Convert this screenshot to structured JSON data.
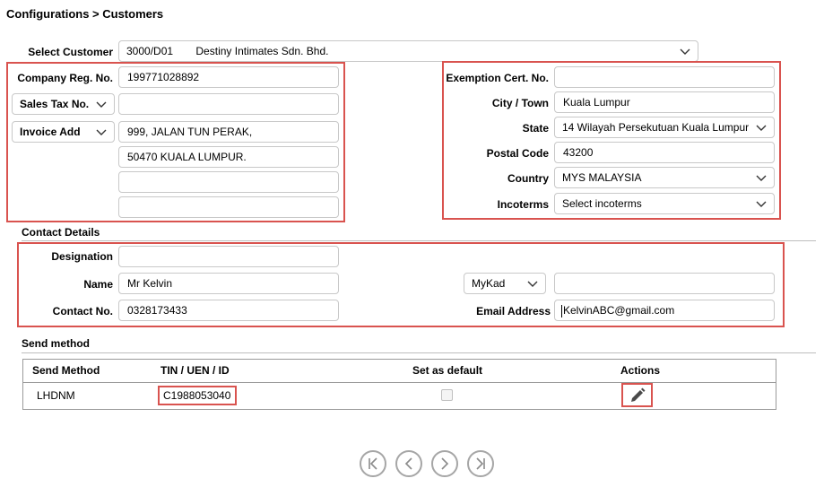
{
  "breadcrumb": "Configurations > Customers",
  "select_customer": {
    "label": "Select Customer",
    "code": "3000/D01",
    "name": "Destiny Intimates Sdn. Bhd."
  },
  "left": {
    "company_reg_label": "Company Reg. No.",
    "company_reg_value": "199771028892",
    "sales_tax_select": "Sales Tax No.",
    "sales_tax_value": "",
    "invoice_add_select": "Invoice Add",
    "address_lines": [
      "999, JALAN TUN PERAK,",
      "50470 KUALA LUMPUR.",
      "",
      ""
    ]
  },
  "right": {
    "exemption_label": "Exemption Cert. No.",
    "exemption_value": "",
    "city_label": "City / Town",
    "city_value": "Kuala Lumpur",
    "state_label": "State",
    "state_value": "14 Wilayah Persekutuan Kuala Lumpur",
    "postal_label": "Postal Code",
    "postal_value": "43200",
    "country_label": "Country",
    "country_value": "MYS MALAYSIA",
    "incoterms_label": "Incoterms",
    "incoterms_value": "Select incoterms"
  },
  "contact": {
    "section_title": "Contact Details",
    "designation_label": "Designation",
    "designation_value": "",
    "name_label": "Name",
    "name_value": "Mr Kelvin",
    "id_type": "MyKad",
    "id_value": "",
    "contact_label": "Contact No.",
    "contact_value": "0328173433",
    "email_label": "Email Address",
    "email_value": "KelvinABC@gmail.com"
  },
  "send": {
    "section_title": "Send method",
    "headers": [
      "Send Method",
      "TIN / UEN / ID",
      "Set as default",
      "Actions"
    ],
    "rows": [
      {
        "method": "LHDNM",
        "tin": "C1988053040",
        "default": false
      }
    ]
  },
  "colors": {
    "highlight": "#d9534f",
    "border": "#c8c8c8"
  },
  "icons": [
    "chevron-down-icon",
    "pencil-icon",
    "first-page-icon",
    "prev-page-icon",
    "next-page-icon",
    "last-page-icon"
  ]
}
